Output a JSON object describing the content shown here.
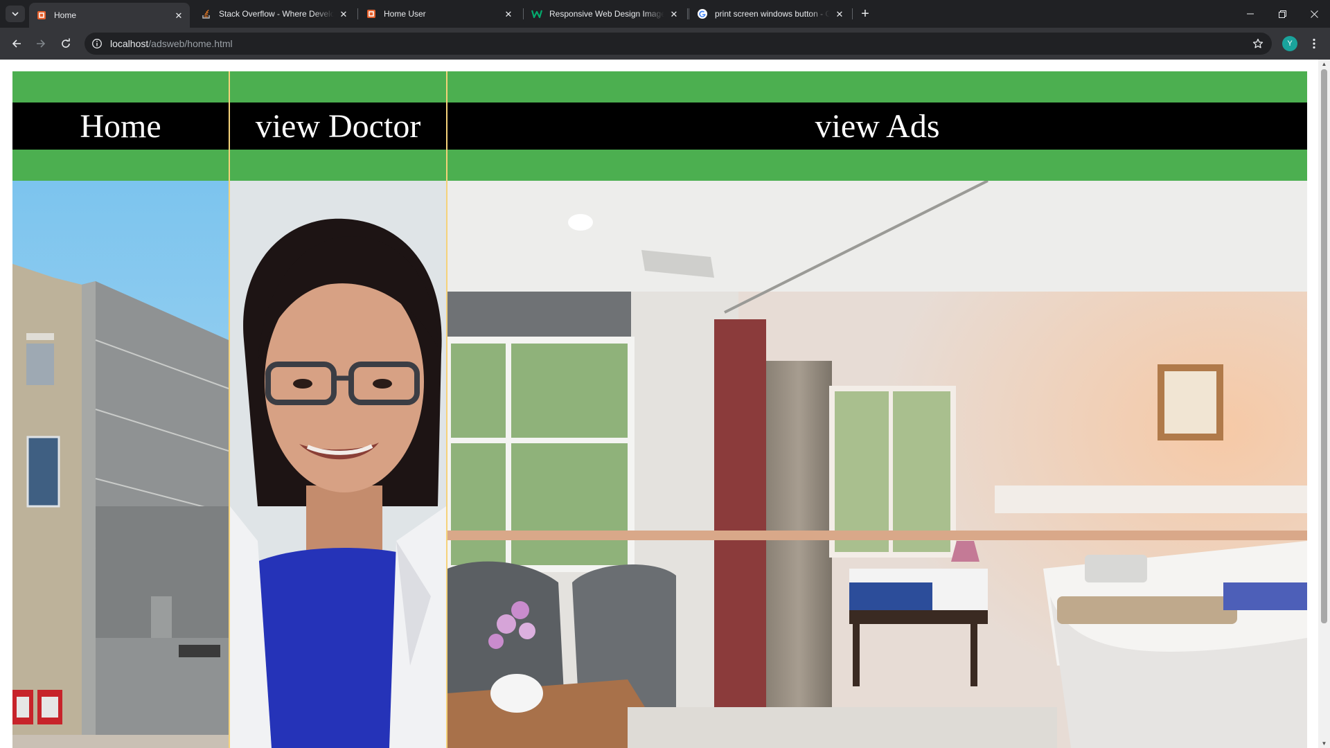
{
  "browser": {
    "tabs": [
      {
        "title": "Home",
        "favicon": "html5-icon",
        "active": true
      },
      {
        "title": "Stack Overflow - Where Developers Learn",
        "favicon": "stackoverflow-icon",
        "active": false
      },
      {
        "title": "Home User",
        "favicon": "html5-icon",
        "active": false
      },
      {
        "title": "Responsive Web Design Images",
        "favicon": "w3schools-icon",
        "active": false
      },
      {
        "title": "print screen windows button - Google Search",
        "favicon": "google-icon",
        "active": false
      }
    ],
    "new_tab_label": "+",
    "close_glyph": "✕",
    "address": {
      "host": "localhost",
      "path": "/adsweb/home.html"
    },
    "profile_initial": "Y"
  },
  "page": {
    "nav": [
      {
        "label": "Home"
      },
      {
        "label": "view Doctor"
      },
      {
        "label": "view Ads"
      }
    ],
    "colors": {
      "band_green": "#4caf50",
      "nav_bg": "#000000",
      "nav_text": "#ffffff",
      "divider": "#f5d27a"
    },
    "photos": [
      "hospital-building-photo",
      "doctor-portrait-photo",
      "hospital-room-photo"
    ]
  }
}
